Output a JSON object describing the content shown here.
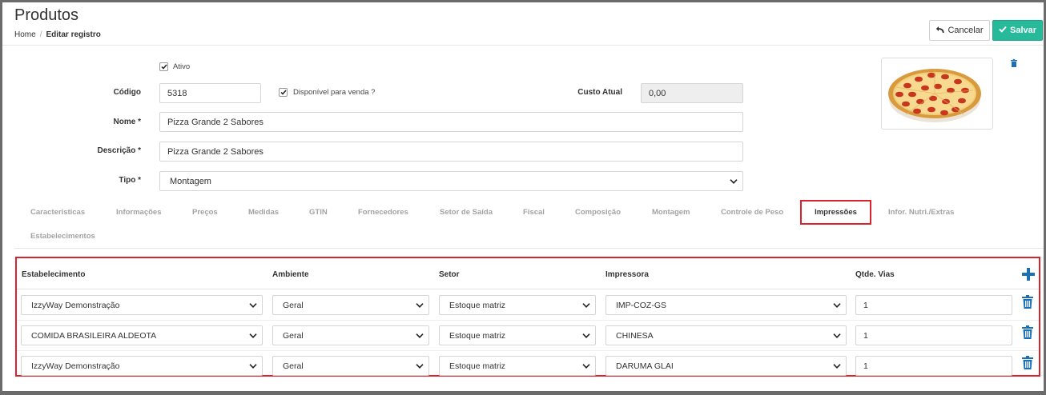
{
  "header": {
    "title": "Produtos",
    "breadcrumb": {
      "home": "Home",
      "separator": "/",
      "current": "Editar registro"
    },
    "cancel_label": "Cancelar",
    "save_label": "Salvar"
  },
  "form": {
    "ativo_label": "Ativo",
    "ativo_checked": true,
    "codigo_label": "Código",
    "codigo_value": "5318",
    "disponivel_label": "Disponível para venda ?",
    "disponivel_checked": true,
    "custo_label": "Custo Atual",
    "custo_value": "0,00",
    "nome_label": "Nome *",
    "nome_value": "Pizza Grande 2 Sabores",
    "descricao_label": "Descrição *",
    "descricao_value": "Pizza Grande 2 Sabores",
    "tipo_label": "Tipo *",
    "tipo_value": "Montagem"
  },
  "tabs": [
    "Caracteristicas",
    "Informações",
    "Preços",
    "Medidas",
    "GTIN",
    "Fornecedores",
    "Setor de Saída",
    "Fiscal",
    "Composição",
    "Montagem",
    "Controle de Peso",
    "Impressões",
    "Infor. Nutri./Extras",
    "Estabelecimentos"
  ],
  "active_tab": "Impressões",
  "grid": {
    "headers": [
      "Estabelecimento",
      "Ambiente",
      "Setor",
      "Impressora",
      "Qtde. Vias"
    ],
    "rows": [
      [
        "IzzyWay Demonstração",
        "Geral",
        "Estoque matriz",
        "IMP-COZ-GS",
        "1"
      ],
      [
        "COMIDA BRASILEIRA ALDEOTA",
        "Geral",
        "Estoque matriz",
        "CHINESA",
        "1"
      ],
      [
        "IzzyWay Demonstração",
        "Geral",
        "Estoque matriz",
        "DARUMA GLAI",
        "1"
      ]
    ]
  },
  "icons": {
    "cancel": "undo-arrow-icon",
    "save": "check-icon",
    "add": "plus-icon",
    "delete": "trash-icon",
    "dropdown": "chevron-down-icon"
  },
  "colors": {
    "save_button": "#26b99a",
    "highlight_border": "#d9232d",
    "icon_blue": "#1a6fb5"
  }
}
